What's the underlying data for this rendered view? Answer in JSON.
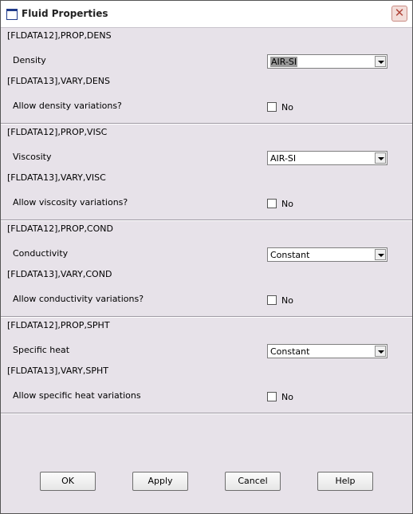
{
  "window": {
    "title": "Fluid Properties",
    "close_glyph": "✕"
  },
  "sections": [
    {
      "prop_cmd": "[FLDATA12],PROP,DENS",
      "prop_label": "Density",
      "select_value": "AIR-SI",
      "vary_cmd": "[FLDATA13],VARY,DENS",
      "vary_label": "Allow density variations?",
      "checkbox_label": "No"
    },
    {
      "prop_cmd": "[FLDATA12],PROP,VISC",
      "prop_label": "Viscosity",
      "select_value": "AIR-SI",
      "vary_cmd": "[FLDATA13],VARY,VISC",
      "vary_label": "Allow viscosity variations?",
      "checkbox_label": "No"
    },
    {
      "prop_cmd": "[FLDATA12],PROP,COND",
      "prop_label": "Conductivity",
      "select_value": "Constant",
      "vary_cmd": "[FLDATA13],VARY,COND",
      "vary_label": "Allow conductivity variations?",
      "checkbox_label": "No"
    },
    {
      "prop_cmd": "[FLDATA12],PROP,SPHT",
      "prop_label": "Specific heat",
      "select_value": "Constant",
      "vary_cmd": "[FLDATA13],VARY,SPHT",
      "vary_label": "Allow specific heat variations",
      "checkbox_label": "No"
    }
  ],
  "buttons": {
    "ok": "OK",
    "apply": "Apply",
    "cancel": "Cancel",
    "help": "Help"
  }
}
